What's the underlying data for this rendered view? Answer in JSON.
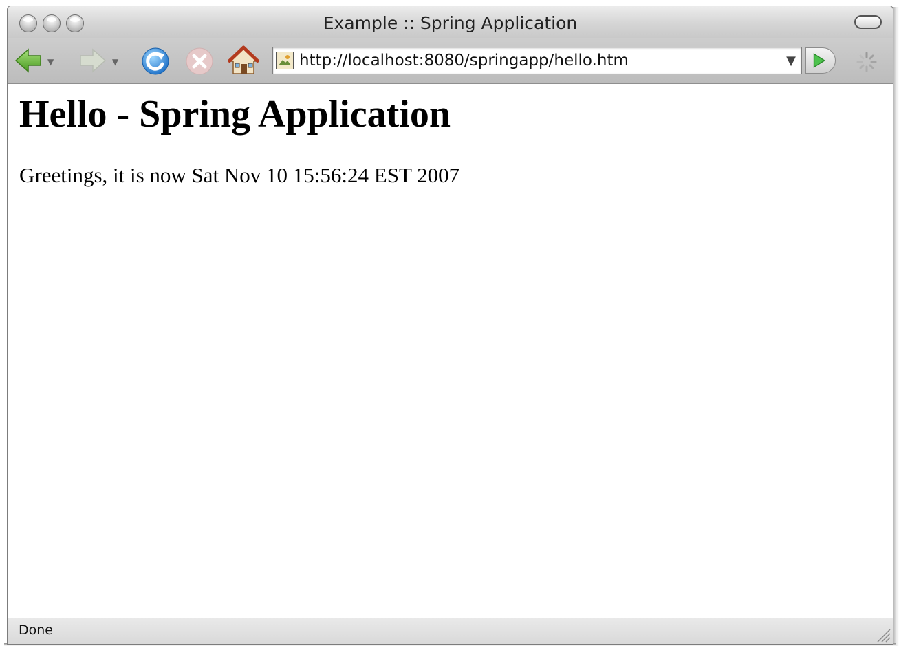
{
  "window": {
    "title": "Example :: Spring Application"
  },
  "toolbar": {
    "back_icon": "back-arrow-icon",
    "forward_icon": "forward-arrow-icon",
    "reload_icon": "reload-icon",
    "stop_icon": "stop-icon",
    "home_icon": "home-icon",
    "go_icon": "go-arrow-icon",
    "throbber_icon": "loading-throbber-icon"
  },
  "address_bar": {
    "value": "http://localhost:8080/springapp/hello.htm",
    "site_icon": "site-favicon"
  },
  "page": {
    "heading": "Hello - Spring Application",
    "greeting": "Greetings, it is now Sat Nov 10 15:56:24 EST 2007"
  },
  "status_bar": {
    "text": "Done"
  },
  "colors": {
    "back_green": "#5fae2e",
    "reload_blue": "#2a8be0",
    "go_green": "#3fae3f"
  }
}
